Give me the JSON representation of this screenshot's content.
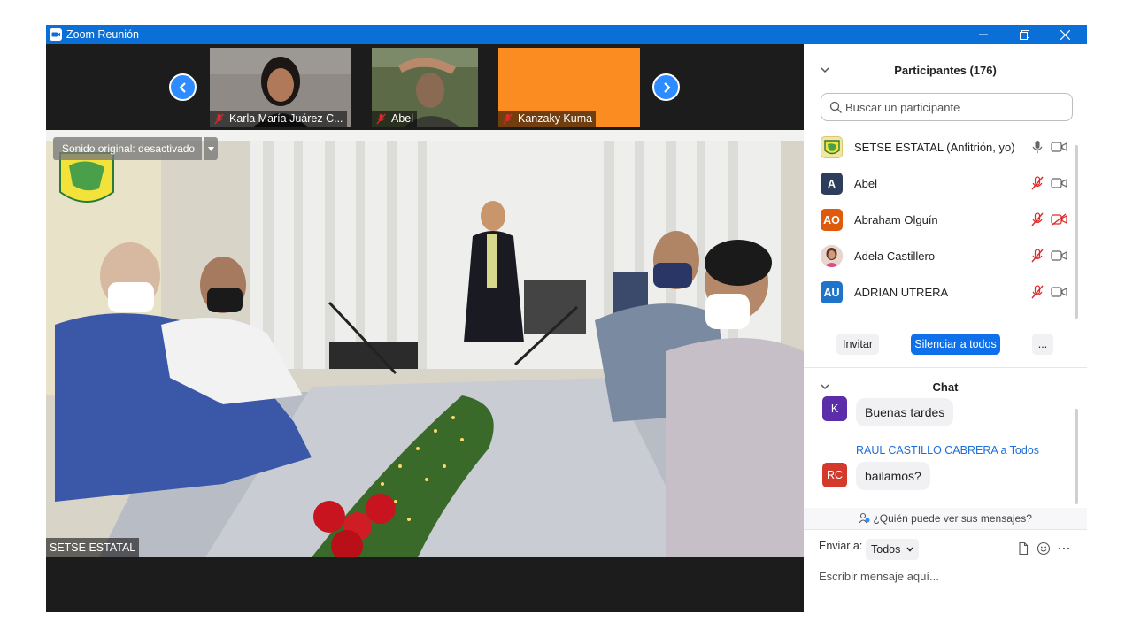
{
  "window": {
    "title": "Zoom Reunión"
  },
  "colors": {
    "accent": "#2d8cff",
    "titlebar": "#0b6fd8",
    "mute_red": "#e02828"
  },
  "thumbnails": [
    {
      "name": "Karla María Juárez C...",
      "muted": true
    },
    {
      "name": "Abel",
      "muted": true
    },
    {
      "name": "Kanzaky Kuma",
      "muted": true
    }
  ],
  "main_video": {
    "original_sound": "Sonido original: desactivado",
    "speaker_name": "SETSE ESTATAL"
  },
  "participants": {
    "title": "Participantes (176)",
    "search_placeholder": "Buscar un participante",
    "list": [
      {
        "initials": "",
        "name": "SETSE ESTATAL (Anfitrión, yo)",
        "avatar_color": "#f2e6a0",
        "mic": "on",
        "video": "on"
      },
      {
        "initials": "A",
        "name": "Abel",
        "avatar_color": "#2c3e5c",
        "mic": "muted",
        "video": "on"
      },
      {
        "initials": "AO",
        "name": "Abraham Olguín",
        "avatar_color": "#e05a0c",
        "mic": "muted",
        "video": "off"
      },
      {
        "initials": "",
        "name": "Adela Castillero",
        "avatar_color": "#d9a0a8",
        "mic": "muted",
        "video": "on"
      },
      {
        "initials": "AU",
        "name": "ADRIAN UTRERA",
        "avatar_color": "#1f74c9",
        "mic": "muted",
        "video": "on"
      }
    ],
    "invite_label": "Invitar",
    "mute_all_label": "Silenciar a todos",
    "more_label": "..."
  },
  "chat": {
    "title": "Chat",
    "messages": [
      {
        "initials": "K",
        "avatar_color": "#5b2da8",
        "sender": "",
        "text": "Buenas tardes"
      },
      {
        "initials": "RC",
        "avatar_color": "#d33a2c",
        "sender": "RAUL CASTILLO CABRERA a Todos",
        "text": "bailamos?"
      }
    ],
    "who_can_see": "¿Quién puede ver sus mensajes?",
    "send_to_label": "Enviar a:",
    "send_to_value": "Todos",
    "input_placeholder": "Escribir mensaje aquí..."
  }
}
